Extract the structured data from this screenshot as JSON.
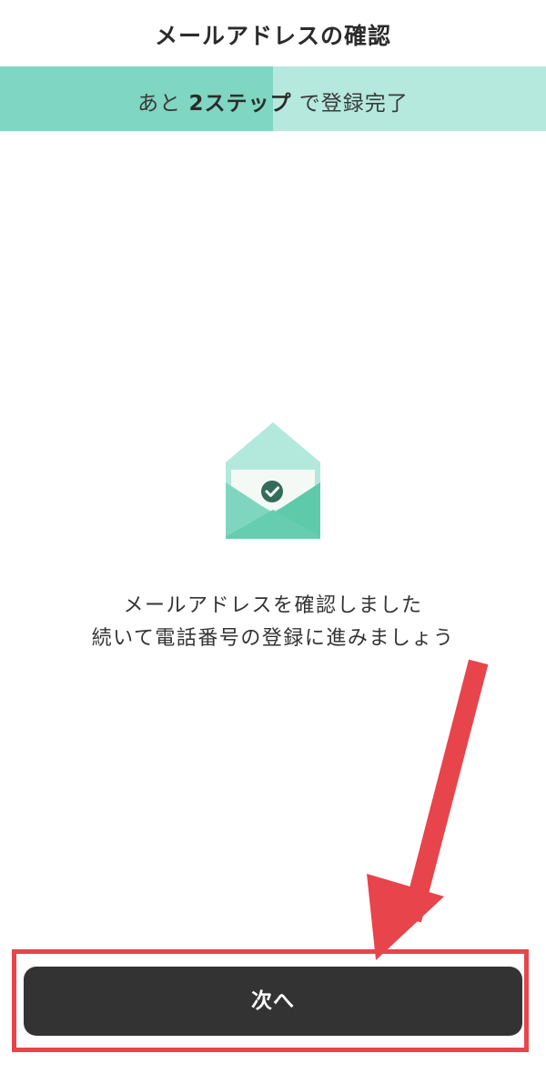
{
  "header": {
    "title": "メールアドレスの確認"
  },
  "progress": {
    "prefix": "あと ",
    "steps_bold": "2ステップ",
    "suffix": " で登録完了",
    "fill_fraction": 0.5,
    "fill_color": "#7fd6c2",
    "track_color": "#b5e9dd"
  },
  "envelope": {
    "icon": "envelope-check-icon",
    "colors": {
      "flap": "#b3e8dc",
      "body": "#7fd6bf",
      "body_dark": "#5fcaa9",
      "letter": "#f4f9f5",
      "check_circle": "#356b5b"
    }
  },
  "message": {
    "line1": "メールアドレスを確認しました",
    "line2": "続いて電話番号の登録に進みましょう"
  },
  "annotation": {
    "color": "#e8444c"
  },
  "footer": {
    "next_label": "次へ"
  }
}
